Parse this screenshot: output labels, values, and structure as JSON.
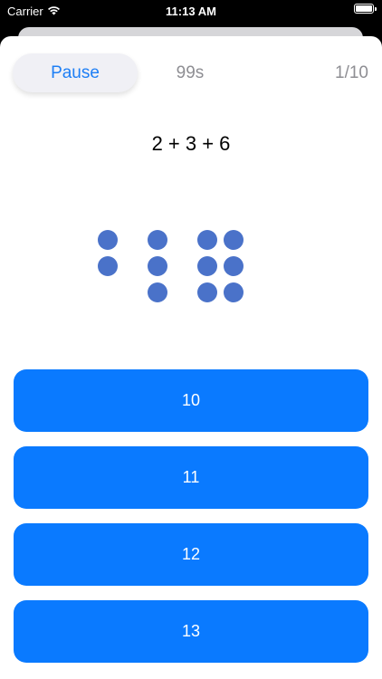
{
  "status_bar": {
    "carrier": "Carrier",
    "time": "11:13 AM",
    "wifi_icon": "wifi-icon",
    "battery_icon": "battery-icon"
  },
  "quiz": {
    "pause_label": "Pause",
    "timer": "99s",
    "progress": "1/10",
    "equation": "2 + 3 + 6",
    "addends": [
      2,
      3,
      6
    ],
    "dot_color": "#4a72c9"
  },
  "answers": [
    {
      "label": "10"
    },
    {
      "label": "11"
    },
    {
      "label": "12"
    },
    {
      "label": "13"
    }
  ],
  "colors": {
    "accent": "#0a7aff",
    "pause_text": "#1e7ff5",
    "muted_text": "#8e8e93"
  }
}
